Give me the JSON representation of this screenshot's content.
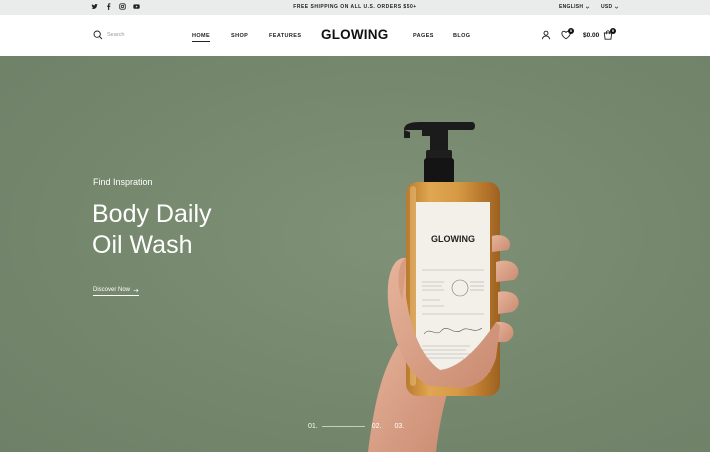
{
  "topbar": {
    "social_icons": [
      "twitter-icon",
      "facebook-icon",
      "instagram-icon",
      "youtube-icon"
    ],
    "promo_text": "FREE SHIPPING ON ALL U.S. ORDERS $50+",
    "language": "ENGLISH",
    "currency": "USD"
  },
  "header": {
    "search_placeholder": "Search",
    "nav_left": [
      "HOME",
      "SHOP",
      "FEATURES"
    ],
    "nav_right": [
      "PAGES",
      "BLOG"
    ],
    "active_nav": "HOME",
    "logo": "GLOWING",
    "wishlist_count": "0",
    "cart_total": "$0.00",
    "cart_count": "0"
  },
  "hero": {
    "eyebrow": "Find Inspration",
    "title_line1": "Body Daily",
    "title_line2": "Oil Wash",
    "cta_label": "Discover Now",
    "product_brand": "GLOWING",
    "slides": [
      "01.",
      "02.",
      "03."
    ],
    "active_slide": "01."
  },
  "colors": {
    "hero_bg": "#77896f",
    "topbar_bg": "#e9ecea",
    "accent": "#111111"
  }
}
